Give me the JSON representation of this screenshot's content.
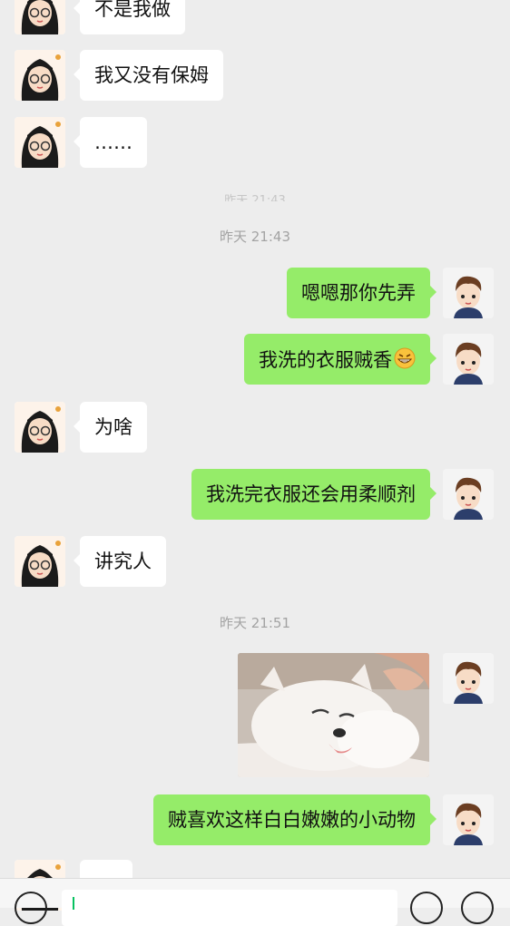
{
  "colors": {
    "background": "#ededed",
    "bubble_in": "#ffffff",
    "bubble_out": "#95ec69",
    "timestamp": "#a3a3a3"
  },
  "messages": [
    {
      "side": "in",
      "text": "不是我做"
    },
    {
      "side": "in",
      "text": "我又没有保姆"
    },
    {
      "side": "in",
      "text": "……"
    },
    {
      "side": "out",
      "text": "嗯嗯那你先弄"
    },
    {
      "side": "out",
      "text": "我洗的衣服贼香",
      "emoji": "grinning-face-icon"
    },
    {
      "side": "in",
      "text": "为啥"
    },
    {
      "side": "out",
      "text": "我洗完衣服还会用柔顺剂"
    },
    {
      "side": "in",
      "text": "讲究人"
    },
    {
      "side": "out",
      "text": "贼喜欢这样白白嫩嫩的小动物"
    }
  ],
  "timestamps": {
    "faded": "昨天 21:43",
    "t1": "昨天 21:43",
    "t2": "昨天 21:51"
  },
  "image_message": {
    "subject": "white fluffy puppy photo"
  }
}
